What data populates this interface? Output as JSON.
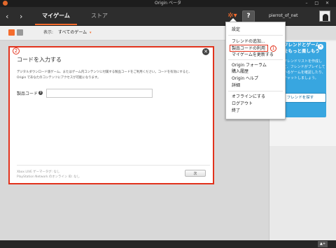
{
  "window": {
    "title": "Origin ベータ",
    "controls": "– □ ✕"
  },
  "nav": {
    "back_glyph": "‹",
    "forward_glyph": "›",
    "tabs": [
      {
        "label": "マイゲーム"
      },
      {
        "label": "ストア"
      }
    ],
    "help_label": "?",
    "username": "pierrot_of_net",
    "gear_glyph": "✲▾"
  },
  "toolbar": {
    "filter_label": "表示:",
    "filter_value": "すべてのゲーム",
    "filter_caret": "▾"
  },
  "menu": {
    "items": [
      "設定",
      "フレンドの追加...",
      "製品コードの利用",
      "マイゲームを更新する",
      "Origin フォーラム",
      "購入履歴",
      "Origin ヘルプ",
      "詳細",
      "オフラインにする",
      "ログアウト",
      "終了"
    ],
    "marker": "1"
  },
  "dialog": {
    "marker": "2",
    "title": "コードを入力する",
    "close_glyph": "✕",
    "description": "デジタルダウンロード版ゲーム、またはゲーム内コンテンツに付属する製品コードをご利用ください。コードを有効にすると、Origin であなたのコンテンツにアクセスが可能になります。",
    "code_label": "製品コード",
    "info_glyph": "?",
    "code_value": "",
    "footer_notes": [
      "Xbox LIVE ゲーマータグ: なし",
      "PlayStation Network のオンライン ID: なし"
    ],
    "next_label": "次"
  },
  "friends_panel": {
    "card_title": "フレンドとゲームをもっと楽しもう",
    "card_text": "フレンドリストを作成して、フレンドがプレイしているゲームを確認したり、チャットしましょう。",
    "close_glyph": "✕",
    "find_button_label": "フレンドを探す"
  },
  "bottombar": {
    "chat_label": "▲+"
  },
  "colors": {
    "accent": "#f56c2d",
    "annotation_red": "#e2321c",
    "friends_blue": "#38a6e0"
  }
}
